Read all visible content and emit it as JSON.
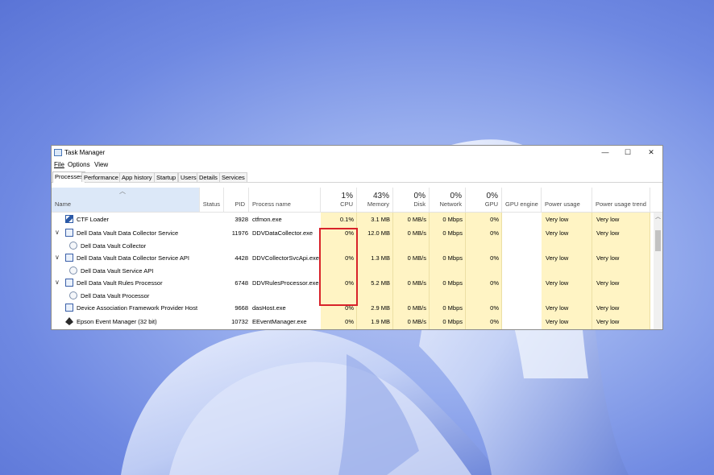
{
  "window": {
    "title": "Task Manager",
    "controls": {
      "minimize": "—",
      "maximize": "☐",
      "close": "✕"
    }
  },
  "menu": [
    "File",
    "Options",
    "View"
  ],
  "tabs": [
    "Processes",
    "Performance",
    "App history",
    "Startup",
    "Users",
    "Details",
    "Services"
  ],
  "active_tab": "Processes",
  "columns": {
    "name": "Name",
    "status": "Status",
    "pid": "PID",
    "process_name": "Process name",
    "cpu": {
      "label": "CPU",
      "pct": "1%"
    },
    "memory": {
      "label": "Memory",
      "pct": "43%"
    },
    "disk": {
      "label": "Disk",
      "pct": "0%"
    },
    "network": {
      "label": "Network",
      "pct": "0%"
    },
    "gpu": {
      "label": "GPU",
      "pct": "0%"
    },
    "gpu_engine": "GPU engine",
    "power_usage": "Power usage",
    "power_trend": "Power usage trend"
  },
  "rows": [
    {
      "name": "CTF Loader",
      "icon": "pen-icon",
      "pid": "3928",
      "process": "ctfmon.exe",
      "cpu": "0.1%",
      "memory": "3.1 MB",
      "disk": "0 MB/s",
      "network": "0 Mbps",
      "gpu": "0%",
      "power": "Very low",
      "trend": "Very low"
    },
    {
      "name": "Dell Data Vault Data Collector Service",
      "icon": "exe-icon",
      "expand": "∨",
      "pid": "11976",
      "process": "DDVDataCollector.exe",
      "cpu": "0%",
      "memory": "12.0 MB",
      "disk": "0 MB/s",
      "network": "0 Mbps",
      "gpu": "0%",
      "power": "Very low",
      "trend": "Very low"
    },
    {
      "name": "Dell Data Vault Collector",
      "icon": "service-icon",
      "child": true
    },
    {
      "name": "Dell Data Vault Data Collector Service API",
      "icon": "exe-icon",
      "expand": "∨",
      "pid": "4428",
      "process": "DDVCollectorSvcApi.exe",
      "cpu": "0%",
      "memory": "1.3 MB",
      "disk": "0 MB/s",
      "network": "0 Mbps",
      "gpu": "0%",
      "power": "Very low",
      "trend": "Very low"
    },
    {
      "name": "Dell Data Vault Service API",
      "icon": "service-icon",
      "child": true
    },
    {
      "name": "Dell Data Vault Rules Processor",
      "icon": "exe-icon",
      "expand": "∨",
      "pid": "6748",
      "process": "DDVRulesProcessor.exe",
      "cpu": "0%",
      "memory": "5.2 MB",
      "disk": "0 MB/s",
      "network": "0 Mbps",
      "gpu": "0%",
      "power": "Very low",
      "trend": "Very low"
    },
    {
      "name": "Dell Data Vault Processor",
      "icon": "service-icon",
      "child": true
    },
    {
      "name": "Device Association Framework Provider Host",
      "icon": "exe-icon",
      "pid": "9668",
      "process": "dasHost.exe",
      "cpu": "0%",
      "memory": "2.9 MB",
      "disk": "0 MB/s",
      "network": "0 Mbps",
      "gpu": "0%",
      "power": "Very low",
      "trend": "Very low"
    },
    {
      "name": "Epson Event Manager (32 bit)",
      "icon": "printer-icon",
      "pid": "10732",
      "process": "EEventManager.exe",
      "cpu": "0%",
      "memory": "1.9 MB",
      "disk": "0 MB/s",
      "network": "0 Mbps",
      "gpu": "0%",
      "power": "Very low",
      "trend": "Very low"
    }
  ],
  "colors": {
    "highlight_box": "#d8232a",
    "heat_column": "#fff4c4",
    "selected_header": "#dce8f8"
  }
}
